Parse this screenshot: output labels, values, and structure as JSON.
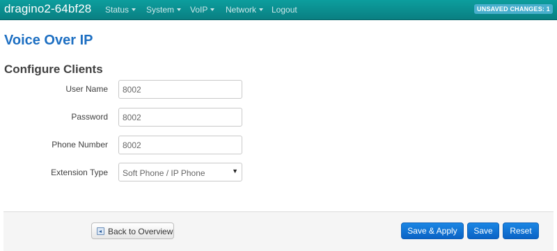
{
  "navbar": {
    "brand": "dragino2-64bf28",
    "menu": [
      {
        "label": "Status"
      },
      {
        "label": "System"
      },
      {
        "label": "VoIP"
      },
      {
        "label": "Network"
      },
      {
        "label": "Logout"
      }
    ],
    "changes_badge": "UNSAVED CHANGES: 1"
  },
  "page": {
    "title": "Voice Over IP",
    "section_title": "Configure Clients"
  },
  "form": {
    "user_name": {
      "label": "User Name",
      "value": "8002"
    },
    "password": {
      "label": "Password",
      "value": "8002"
    },
    "phone_number": {
      "label": "Phone Number",
      "value": "8002"
    },
    "extension_type": {
      "label": "Extension Type",
      "value": "Soft Phone / IP Phone"
    }
  },
  "footer": {
    "back_label": "Back to Overview",
    "save_apply_label": "Save & Apply",
    "save_label": "Save",
    "reset_label": "Reset"
  },
  "colors": {
    "navbar": "#0c9e9e",
    "title": "#1d6fc2",
    "primary_button": "#0a63c5",
    "badge": "#49afcd"
  }
}
